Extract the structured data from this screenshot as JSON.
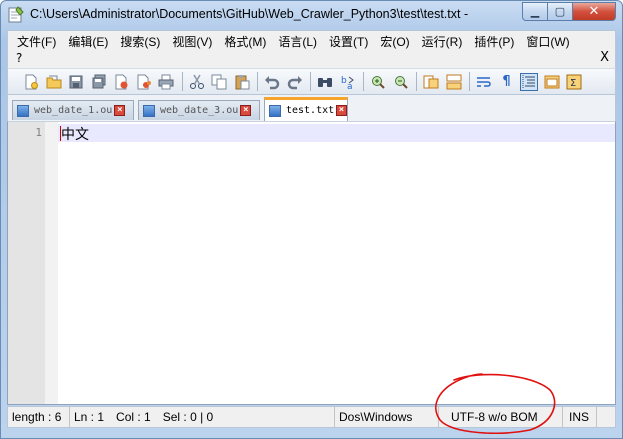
{
  "window": {
    "title": "C:\\Users\\Administrator\\Documents\\GitHub\\Web_Crawler_Python3\\test\\test.txt - ",
    "min_label": "▁",
    "max_label": "▢",
    "close_label": "✕"
  },
  "menu": {
    "items": [
      "文件(F)",
      "编辑(E)",
      "搜索(S)",
      "视图(V)",
      "格式(M)",
      "语言(L)",
      "设置(T)",
      "宏(O)",
      "运行(R)",
      "插件(P)",
      "窗口(W)"
    ],
    "help": "?",
    "close_doc": "X"
  },
  "toolbar": {
    "icons": [
      "new-file-icon",
      "open-file-icon",
      "save-icon",
      "save-all-icon",
      "close-icon",
      "close-all-icon",
      "print-icon",
      "cut-icon",
      "copy-icon",
      "paste-icon",
      "undo-icon",
      "redo-icon",
      "find-icon",
      "replace-icon",
      "zoom-in-icon",
      "zoom-out-icon",
      "sync-vertical-icon",
      "sync-horizontal-icon",
      "word-wrap-icon",
      "show-all-chars-icon",
      "indent-guide-icon",
      "user-define-language-icon",
      "function-list-icon"
    ]
  },
  "tabs": [
    {
      "label": "web_date_1.ou",
      "active": false
    },
    {
      "label": "web_date_3.ou",
      "active": false
    },
    {
      "label": "test.txt",
      "active": true
    }
  ],
  "editor": {
    "line_number": "1",
    "content": "中文"
  },
  "status": {
    "length": "length : 6",
    "ln": "Ln : 1",
    "col": "Col : 1",
    "sel": "Sel : 0 | 0",
    "eol": "Dos\\Windows",
    "encoding": "UTF-8 w/o BOM",
    "mode": "INS"
  },
  "colors": {
    "active_tab_accent": "#f7a52a",
    "current_line": "#e8e8ff",
    "annotation": "#e01010"
  }
}
